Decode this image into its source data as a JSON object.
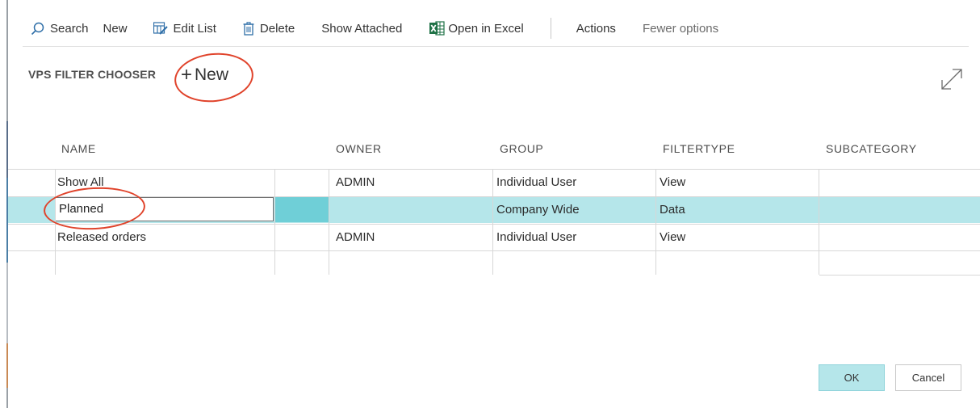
{
  "toolbar": {
    "search_label": "Search",
    "new_label": "New",
    "edit_list_label": "Edit List",
    "delete_label": "Delete",
    "show_attached_label": "Show Attached",
    "open_in_excel_label": "Open in Excel",
    "actions_label": "Actions",
    "fewer_options_label": "Fewer options"
  },
  "page": {
    "title": "VPS FILTER CHOOSER",
    "new_label": "New"
  },
  "grid": {
    "columns": [
      "NAME",
      "OWNER",
      "GROUP",
      "FILTERTYPE",
      "SUBCATEGORY"
    ],
    "rows": [
      {
        "name": "Show All",
        "owner": "ADMIN",
        "group": "Individual User",
        "filtertype": "View",
        "subcategory": ""
      },
      {
        "name": "Planned",
        "owner": "",
        "group": "Company Wide",
        "filtertype": "Data",
        "subcategory": ""
      },
      {
        "name": "Released orders",
        "owner": "ADMIN",
        "group": "Individual User",
        "filtertype": "View",
        "subcategory": ""
      }
    ],
    "selected_row": 1
  },
  "dialog": {
    "ok_label": "OK",
    "cancel_label": "Cancel"
  },
  "icons": {
    "search": "search-icon",
    "edit_list": "edit-list-icon",
    "delete": "trash-icon",
    "excel": "excel-icon",
    "expand": "expand-icon"
  },
  "colors": {
    "selection": "#b5e6ea",
    "selection_marker": "#6fcfd7",
    "annotation": "#e0432b",
    "excel_green": "#1e7145",
    "primary_icon": "#2f6fa8"
  }
}
